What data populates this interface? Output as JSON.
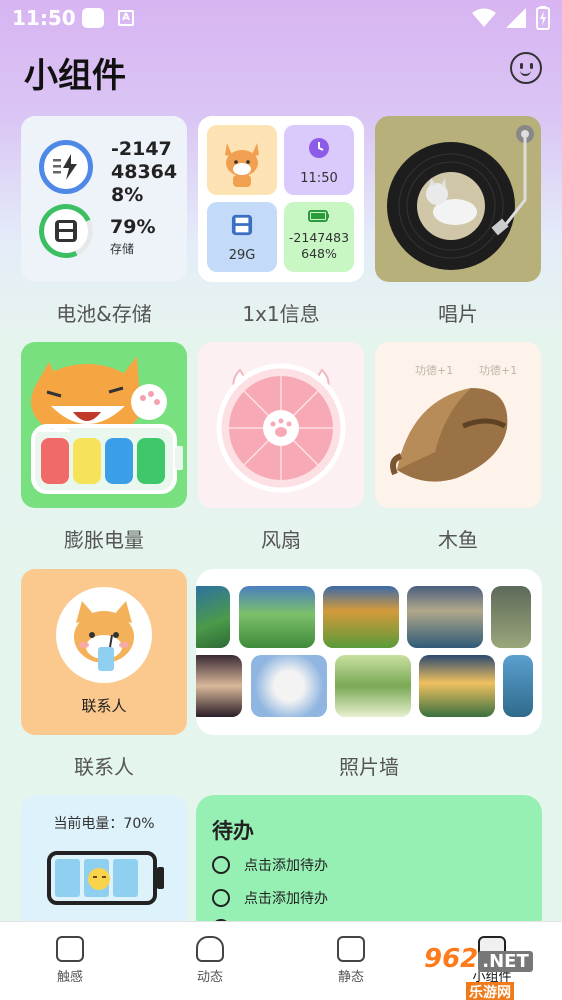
{
  "status": {
    "time": "11:50"
  },
  "header": {
    "title": "小组件"
  },
  "widgets": {
    "battery_storage": {
      "battery_value": "-2147483648%",
      "storage_pct": "79%",
      "storage_label": "存储",
      "label": "电池&存储"
    },
    "info": {
      "time": "11:50",
      "storage": "29G",
      "battery": "-2147483648%",
      "label": "1x1信息"
    },
    "record": {
      "label": "唱片"
    },
    "swell_battery": {
      "label": "膨胀电量"
    },
    "fan": {
      "label": "风扇"
    },
    "wooden_fish": {
      "label": "木鱼",
      "merit1": "功德+1",
      "merit2": "功德+1"
    },
    "contact": {
      "name": "联系人",
      "label": "联系人"
    },
    "photo_wall": {
      "label": "照片墙"
    },
    "current_battery": {
      "text": "当前电量：70%",
      "level": 0.7
    },
    "todo": {
      "title": "待办",
      "items": [
        "点击添加待办",
        "点击添加待办"
      ]
    }
  },
  "nav": {
    "items": [
      "触感",
      "动态",
      "静态",
      "小组件"
    ]
  },
  "watermark": {
    "main": "962",
    "net": ".NET",
    "sub": "乐游网"
  },
  "colors": {
    "accent": "#96f0b4",
    "battery_ring": "#4f89e8",
    "storage_ring": "#3cbf62"
  }
}
